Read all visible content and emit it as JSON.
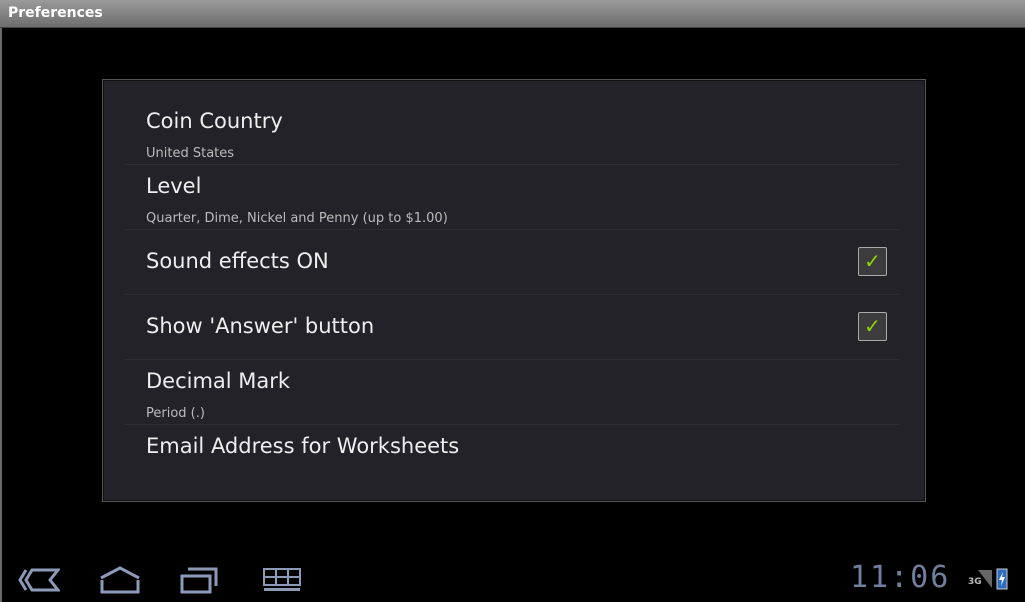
{
  "window": {
    "title": "Preferences"
  },
  "preferences": [
    {
      "title": "Coin Country",
      "summary": "United States"
    },
    {
      "title": "Level",
      "summary": "Quarter, Dime, Nickel and Penny (up to $1.00)"
    },
    {
      "title": "Sound effects ON",
      "checked": true
    },
    {
      "title": "Show 'Answer' button",
      "checked": true
    },
    {
      "title": "Decimal Mark",
      "summary": "Period (.)"
    },
    {
      "title": "Email Address for Worksheets"
    }
  ],
  "status": {
    "time": "11:06",
    "network": "3G",
    "check_glyph": "✓"
  }
}
